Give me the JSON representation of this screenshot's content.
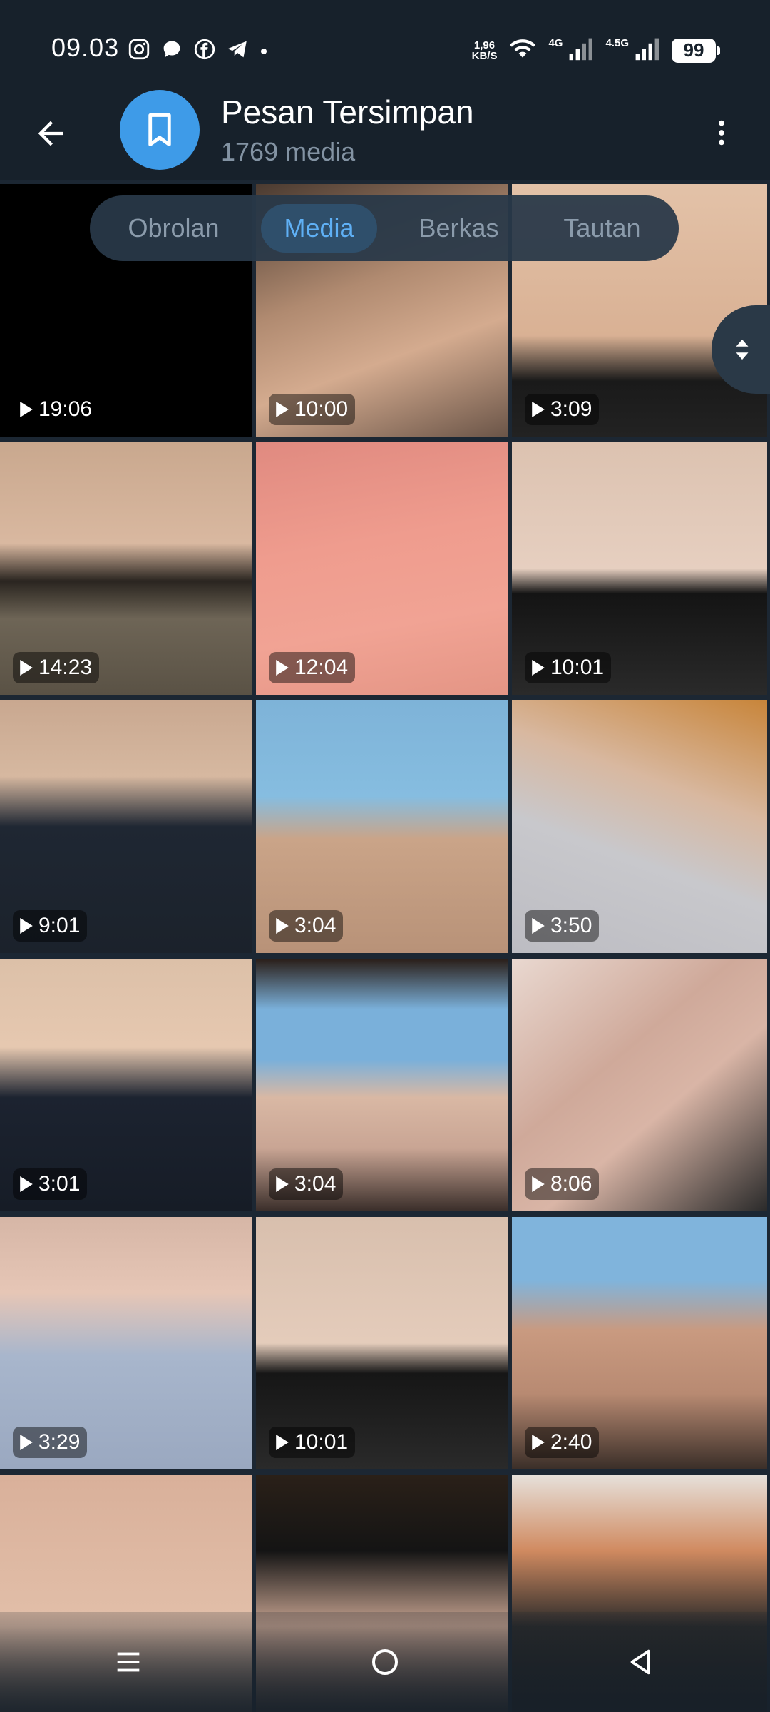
{
  "status_bar": {
    "time": "09.03",
    "net_speed_value": "1,96",
    "net_speed_unit": "KB/S",
    "signal1_label": "4G",
    "signal2_label": "4.5G",
    "battery": "99"
  },
  "header": {
    "title": "Pesan Tersimpan",
    "subtitle": "1769 media"
  },
  "tabs": [
    {
      "label": "Obrolan"
    },
    {
      "label": "Media"
    },
    {
      "label": "Berkas"
    },
    {
      "label": "Tautan"
    }
  ],
  "media": [
    {
      "duration": "19:06"
    },
    {
      "duration": "10:00"
    },
    {
      "duration": "3:09"
    },
    {
      "duration": "14:23"
    },
    {
      "duration": "12:04"
    },
    {
      "duration": "10:01"
    },
    {
      "duration": "9:01"
    },
    {
      "duration": "3:04"
    },
    {
      "duration": "3:50"
    },
    {
      "duration": "3:01"
    },
    {
      "duration": "3:04"
    },
    {
      "duration": "8:06"
    },
    {
      "duration": "3:29"
    },
    {
      "duration": "10:01"
    },
    {
      "duration": "2:40"
    },
    {
      "duration": ""
    },
    {
      "duration": ""
    },
    {
      "duration": ""
    }
  ],
  "colors": {
    "accent": "#3e9be8",
    "active_tab_text": "#5fb0f5",
    "header_bg": "#17212b"
  },
  "icons": {
    "back": "arrow-left-icon",
    "avatar": "bookmark-icon",
    "more": "more-vertical-icon",
    "play": "play-icon",
    "nav_menu": "menu-icon",
    "nav_home": "home-circle-icon",
    "nav_back": "triangle-back-icon"
  }
}
